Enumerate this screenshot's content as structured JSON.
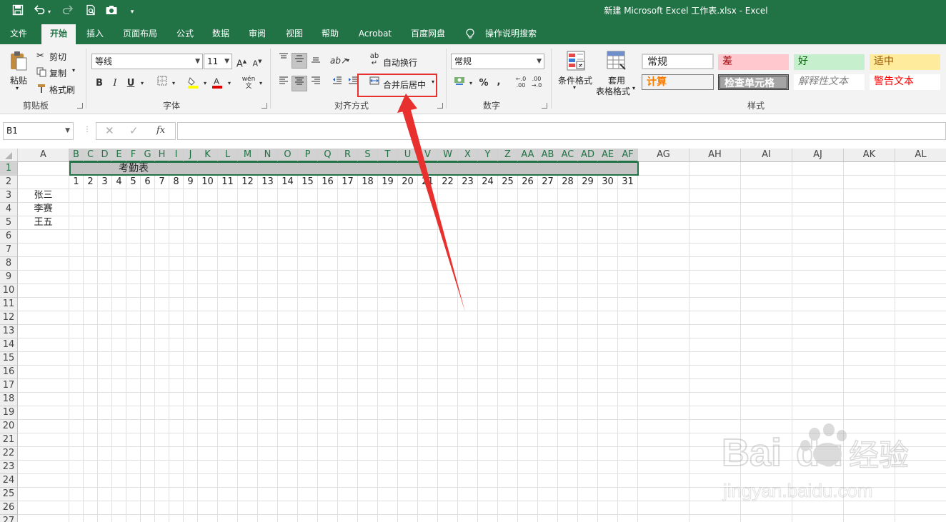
{
  "window": {
    "title": "新建 Microsoft Excel 工作表.xlsx  -  Excel"
  },
  "quick_access": {
    "icons": [
      "save-icon",
      "undo-icon",
      "redo-icon",
      "print-preview-icon",
      "camera-icon",
      "customize-icon"
    ]
  },
  "menu": {
    "items": [
      "文件",
      "开始",
      "插入",
      "页面布局",
      "公式",
      "数据",
      "审阅",
      "视图",
      "帮助",
      "Acrobat",
      "百度网盘",
      "操作说明搜索"
    ],
    "active": "开始"
  },
  "ribbon": {
    "clipboard": {
      "paste": "粘贴",
      "cut": "剪切",
      "copy": "复制",
      "format_painter": "格式刷",
      "label": "剪贴板"
    },
    "font": {
      "name": "等线",
      "size": "11",
      "bold": "B",
      "italic": "I",
      "underline": "U",
      "label": "字体"
    },
    "alignment": {
      "wrap": "自动换行",
      "merge": "合并后居中",
      "label": "对齐方式"
    },
    "number": {
      "format": "常规",
      "percent": "%",
      "comma": ",",
      "label": "数字"
    },
    "styles": {
      "conditional": "条件格式",
      "table_line1": "套用",
      "table_line2": "表格格式",
      "cells": [
        {
          "text": "常规",
          "color": "#222222",
          "bg": "#ffffff"
        },
        {
          "text": "差",
          "color": "#9c0006",
          "bg": "#ffc7ce"
        },
        {
          "text": "好",
          "color": "#006100",
          "bg": "#c6efce"
        },
        {
          "text": "适中",
          "color": "#9c5700",
          "bg": "#ffeb9c"
        },
        {
          "text": "计算",
          "color": "#fa7d00",
          "bg": "#f2f2f2"
        },
        {
          "text": "检查单元格",
          "color": "#ffffff",
          "bg": "#a5a5a5"
        },
        {
          "text": "解释性文本",
          "color": "#7f7f7f",
          "bg": "#ffffff"
        },
        {
          "text": "警告文本",
          "color": "#ff0000",
          "bg": "#ffffff"
        }
      ],
      "label": "样式"
    }
  },
  "formula_bar": {
    "name_box": "B1",
    "fx": "fx",
    "formula": ""
  },
  "sheet": {
    "columns": [
      "A",
      "B",
      "C",
      "D",
      "E",
      "F",
      "G",
      "H",
      "I",
      "J",
      "K",
      "L",
      "M",
      "N",
      "O",
      "P",
      "Q",
      "R",
      "S",
      "T",
      "U",
      "V",
      "W",
      "X",
      "Y",
      "Z",
      "AA",
      "AB",
      "AC",
      "AD",
      "AE",
      "AF",
      "AG",
      "AH",
      "AI",
      "AJ",
      "AK",
      "AL"
    ],
    "rows": [
      "1",
      "2",
      "3",
      "4",
      "5",
      "6",
      "7",
      "8",
      "9",
      "10",
      "11",
      "12",
      "13",
      "14",
      "15",
      "16",
      "17",
      "18",
      "19",
      "20",
      "21",
      "22",
      "23",
      "24",
      "25",
      "26",
      "27"
    ],
    "merged_title": "考勤表",
    "days": [
      "1",
      "2",
      "3",
      "4",
      "5",
      "6",
      "7",
      "8",
      "9",
      "10",
      "11",
      "12",
      "13",
      "14",
      "15",
      "16",
      "17",
      "18",
      "19",
      "20",
      "21",
      "22",
      "23",
      "24",
      "25",
      "26",
      "27",
      "28",
      "29",
      "30",
      "31"
    ],
    "names": [
      "张三",
      "李赛",
      "王五"
    ]
  },
  "watermark": {
    "brand": "Bai",
    "brand2": "du",
    "cn": "经验",
    "url": "jingyan.baidu.com"
  },
  "annotation": {
    "color": "#e8312f"
  }
}
